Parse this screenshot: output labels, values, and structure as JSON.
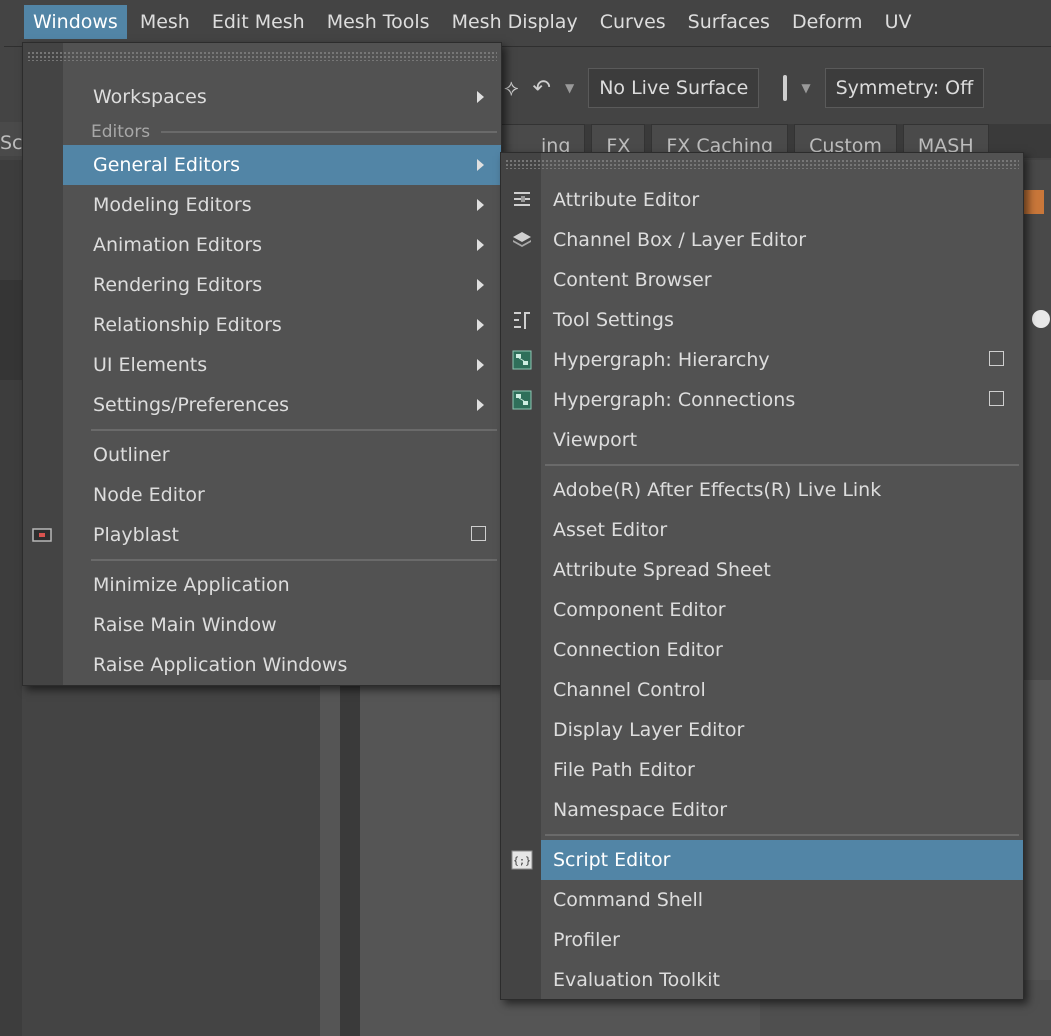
{
  "menubar": {
    "items": [
      "Windows",
      "Mesh",
      "Edit Mesh",
      "Mesh Tools",
      "Mesh Display",
      "Curves",
      "Surfaces",
      "Deform",
      "UV"
    ]
  },
  "toolbar": {
    "live_surface": "No Live Surface",
    "symmetry": "Symmetry: Off"
  },
  "shelf_tabs": [
    "ing",
    "FX",
    "FX Caching",
    "Custom",
    "MASH"
  ],
  "left_tab": "Sc",
  "windows_menu": {
    "workspaces": "Workspaces",
    "editors_section": "Editors",
    "editors": [
      "General Editors",
      "Modeling Editors",
      "Animation Editors",
      "Rendering Editors",
      "Relationship Editors",
      "UI Elements",
      "Settings/Preferences"
    ],
    "panels": [
      "Outliner",
      "Node Editor",
      "Playblast"
    ],
    "app": [
      "Minimize Application",
      "Raise Main Window",
      "Raise Application Windows"
    ]
  },
  "general_editors_menu": {
    "group1": [
      "Attribute Editor",
      "Channel Box / Layer Editor",
      "Content Browser",
      "Tool Settings",
      "Hypergraph: Hierarchy",
      "Hypergraph: Connections",
      "Viewport"
    ],
    "group2": [
      "Adobe(R) After Effects(R) Live Link",
      "Asset Editor",
      "Attribute Spread Sheet",
      "Component Editor",
      "Connection Editor",
      "Channel Control",
      "Display Layer Editor",
      "File Path Editor",
      "Namespace Editor"
    ],
    "group3": [
      "Script Editor",
      "Command Shell",
      "Profiler",
      "Evaluation Toolkit"
    ]
  },
  "colors": {
    "highlight": "#5285a6",
    "menu_bg": "#525252",
    "gutter_bg": "#444444"
  }
}
